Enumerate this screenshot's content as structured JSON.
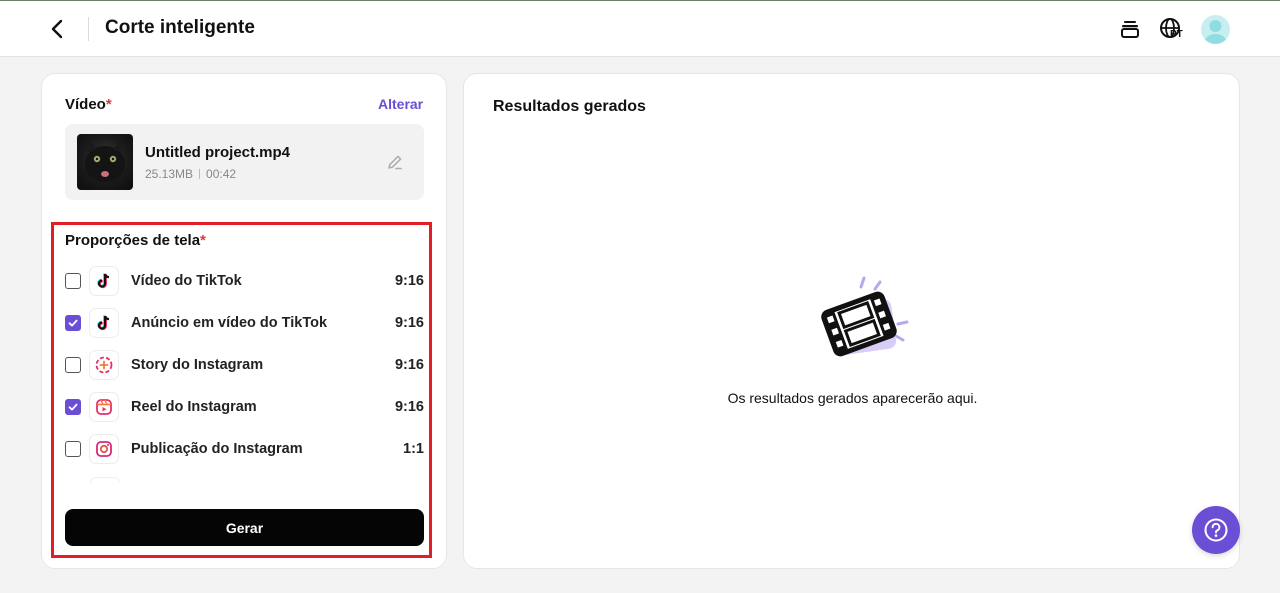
{
  "header": {
    "title": "Corte inteligente",
    "language_code": "PT"
  },
  "video_section": {
    "label": "Vídeo",
    "required_mark": "*",
    "change_label": "Alterar",
    "file_name": "Untitled project.mp4",
    "file_size": "25.13MB",
    "duration": "00:42"
  },
  "ratio_section": {
    "label": "Proporções de tela",
    "required_mark": "*",
    "items": [
      {
        "label": "Vídeo do TikTok",
        "ratio": "9:16",
        "checked": false,
        "icon": "tiktok-icon"
      },
      {
        "label": "Anúncio em vídeo do TikTok",
        "ratio": "9:16",
        "checked": true,
        "icon": "tiktok-icon"
      },
      {
        "label": "Story do Instagram",
        "ratio": "9:16",
        "checked": false,
        "icon": "instagram-story-icon"
      },
      {
        "label": "Reel do Instagram",
        "ratio": "9:16",
        "checked": true,
        "icon": "instagram-reel-icon"
      },
      {
        "label": "Publicação do Instagram",
        "ratio": "1:1",
        "checked": false,
        "icon": "instagram-icon"
      }
    ]
  },
  "generate_label": "Gerar",
  "results": {
    "title": "Resultados gerados",
    "empty_text": "Os resultados gerados aparecerão aqui."
  },
  "colors": {
    "accent": "#6a4fd6",
    "required": "#e4343a",
    "highlight": "#e31c25",
    "button_bg": "#050505"
  }
}
